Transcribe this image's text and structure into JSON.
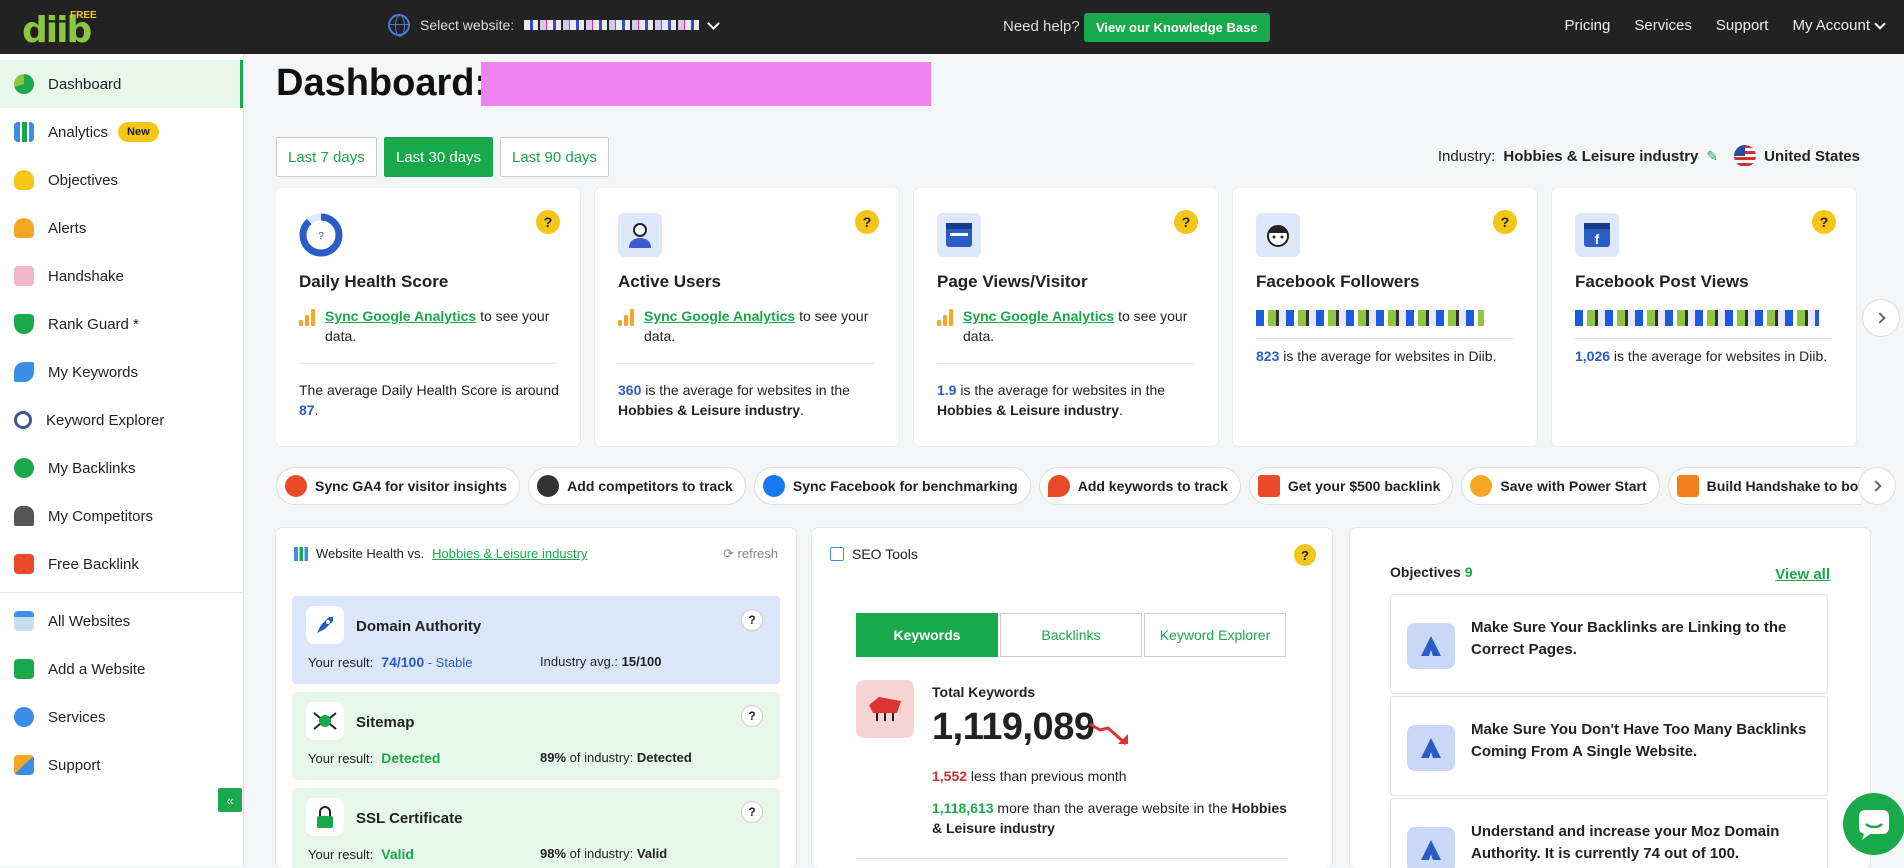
{
  "brand": {
    "logo_text": "diib",
    "free_label": "FREE",
    "green": "#19a84a"
  },
  "topbar": {
    "select_label": "Select website:",
    "help_text": "Need help?",
    "kb_button": "View our Knowledge Base",
    "nav": [
      "Pricing",
      "Services",
      "Support",
      "My Account"
    ]
  },
  "sidebar": {
    "items": [
      {
        "label": "Dashboard",
        "icon": "dashboard-icon",
        "color": "#19a84a"
      },
      {
        "label": "Analytics",
        "icon": "analytics-icon",
        "color": "#3a8ee6",
        "badge": "New"
      },
      {
        "label": "Objectives",
        "icon": "lightbulb-icon",
        "color": "#f5c518"
      },
      {
        "label": "Alerts",
        "icon": "bell-icon",
        "color": "#f5a623"
      },
      {
        "label": "Handshake",
        "icon": "handshake-icon",
        "color": "#e88ca6"
      },
      {
        "label": "Rank Guard *",
        "icon": "shield-icon",
        "color": "#19a84a"
      },
      {
        "label": "My Keywords",
        "icon": "keywords-icon",
        "color": "#3a8ee6"
      },
      {
        "label": "Keyword Explorer",
        "icon": "magnifier-icon",
        "color": "#3b5998"
      },
      {
        "label": "My Backlinks",
        "icon": "link-icon",
        "color": "#19a84a"
      },
      {
        "label": "My Competitors",
        "icon": "chess-icon",
        "color": "#555"
      },
      {
        "label": "Free Backlink",
        "icon": "gift-icon",
        "color": "#e84a2a"
      },
      {
        "label": "All Websites",
        "icon": "websites-icon",
        "color": "#3a8ee6"
      },
      {
        "label": "Add a Website",
        "icon": "add-website-icon",
        "color": "#19a84a"
      },
      {
        "label": "Services",
        "icon": "services-icon",
        "color": "#3a8ee6"
      },
      {
        "label": "Support",
        "icon": "wrench-icon",
        "color": "#f5a623"
      }
    ],
    "collapse_icon": "«"
  },
  "header": {
    "title": "Dashboard:"
  },
  "ranges": [
    "Last 7 days",
    "Last 30 days",
    "Last 90 days"
  ],
  "industry": {
    "label": "Industry:",
    "value": "Hobbies & Leisure industry",
    "country": "United States"
  },
  "cards": [
    {
      "title": "Daily Health Score",
      "sync_link": "Sync Google Analytics",
      "sync_text": " to see your data.",
      "foot_pre": "The average Daily Health Score is around ",
      "foot_num": "87",
      "foot_post": "."
    },
    {
      "title": "Active Users",
      "sync_link": "Sync Google Analytics",
      "sync_text": " to see your data.",
      "foot_num": "360",
      "foot_pre": " is the average for websites in the ",
      "foot_bold": "Hobbies & Leisure industry",
      "foot_post": "."
    },
    {
      "title": "Page Views/Visitor",
      "sync_link": "Sync Google Analytics",
      "sync_text": " to see your data.",
      "foot_num": "1.9",
      "foot_pre": " is the average for websites in the ",
      "foot_bold": "Hobbies & Leisure industry",
      "foot_post": "."
    },
    {
      "title": "Facebook Followers",
      "foot_num": "823",
      "foot_pre": " is the average for websites in Diib."
    },
    {
      "title": "Facebook Post Views",
      "foot_num": "1,026",
      "foot_pre": " is the average for websites in Diib."
    }
  ],
  "chips": [
    {
      "label": "Sync GA4 for visitor insights",
      "icon": "ga4-icon",
      "color": "#e84a2a"
    },
    {
      "label": "Add competitors to track",
      "icon": "chess-icon",
      "color": "#333"
    },
    {
      "label": "Sync Facebook for benchmarking",
      "icon": "facebook-icon",
      "color": "#1877f2"
    },
    {
      "label": "Add keywords to track",
      "icon": "pin-icon",
      "color": "#e84a2a"
    },
    {
      "label": "Get your $500 backlink",
      "icon": "gift-icon",
      "color": "#e84a2a"
    },
    {
      "label": "Save with Power Start",
      "icon": "power-start-icon",
      "color": "#f5a623"
    },
    {
      "label": "Build Handshake to boost",
      "icon": "handshake-icon",
      "color": "#f08020"
    }
  ],
  "health": {
    "title": "Website Health vs.",
    "link": "Hobbies & Leisure industry",
    "refresh": "refresh",
    "metrics": [
      {
        "name": "Domain Authority",
        "result_label": "Your result:",
        "result": "74/100",
        "status": " - Stable",
        "avg_label": "Industry avg.:",
        "avg": "15/100",
        "bg": "#dce6fb",
        "result_color": "#2a5cc6"
      },
      {
        "name": "Sitemap",
        "result_label": "Your result:",
        "result": "Detected",
        "avg_pct": "89%",
        "avg_label": " of industry:",
        "avg": "Detected",
        "bg": "#e6f6ea",
        "result_color": "#19a84a"
      },
      {
        "name": "SSL Certificate",
        "result_label": "Your result:",
        "result": "Valid",
        "avg_pct": "98%",
        "avg_label": " of industry:",
        "avg": "Valid",
        "bg": "#e6f6ea",
        "result_color": "#19a84a"
      }
    ]
  },
  "seo": {
    "title": "SEO Tools",
    "tabs": [
      "Keywords",
      "Backlinks",
      "Keyword Explorer"
    ],
    "total_label": "Total Keywords",
    "total": "1,119,089",
    "less_num": "1,552",
    "less_text": " less than previous month",
    "more_num": "1,118,613",
    "more_text": " more than the average website in the ",
    "more_bold": "Hobbies & Leisure industry"
  },
  "objectives": {
    "title": "Objectives",
    "count": "9",
    "view_all": "View all",
    "items": [
      "Make Sure Your Backlinks are Linking to the Correct Pages.",
      "Make Sure You Don't Have Too Many Backlinks Coming From A Single Website.",
      "Understand and increase your Moz Domain Authority. It is currently 74 out of 100."
    ]
  }
}
